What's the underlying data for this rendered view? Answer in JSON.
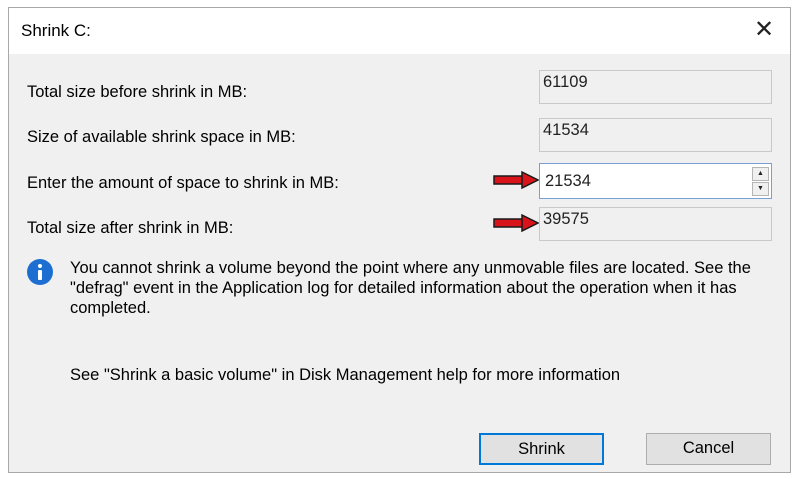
{
  "dialog": {
    "title": "Shrink C:",
    "close_icon": "close-icon"
  },
  "rows": [
    {
      "label": "Total size before shrink in MB:",
      "value": "61109"
    },
    {
      "label": "Size of available shrink space in MB:",
      "value": "41534"
    },
    {
      "label": "Enter the amount of space to shrink in MB:",
      "value": "21534"
    },
    {
      "label": "Total size after shrink in MB:",
      "value": "39575"
    }
  ],
  "info": {
    "icon": "info-icon",
    "text": "You cannot shrink a volume beyond the point where any unmovable files are located. See the \"defrag\" event in the Application log for detailed information about the operation when it has completed."
  },
  "help_text": "See \"Shrink a basic volume\" in Disk Management help for more information",
  "buttons": {
    "shrink": "Shrink",
    "cancel": "Cancel"
  },
  "annotations": {
    "arrow_color": "#d8141a"
  }
}
